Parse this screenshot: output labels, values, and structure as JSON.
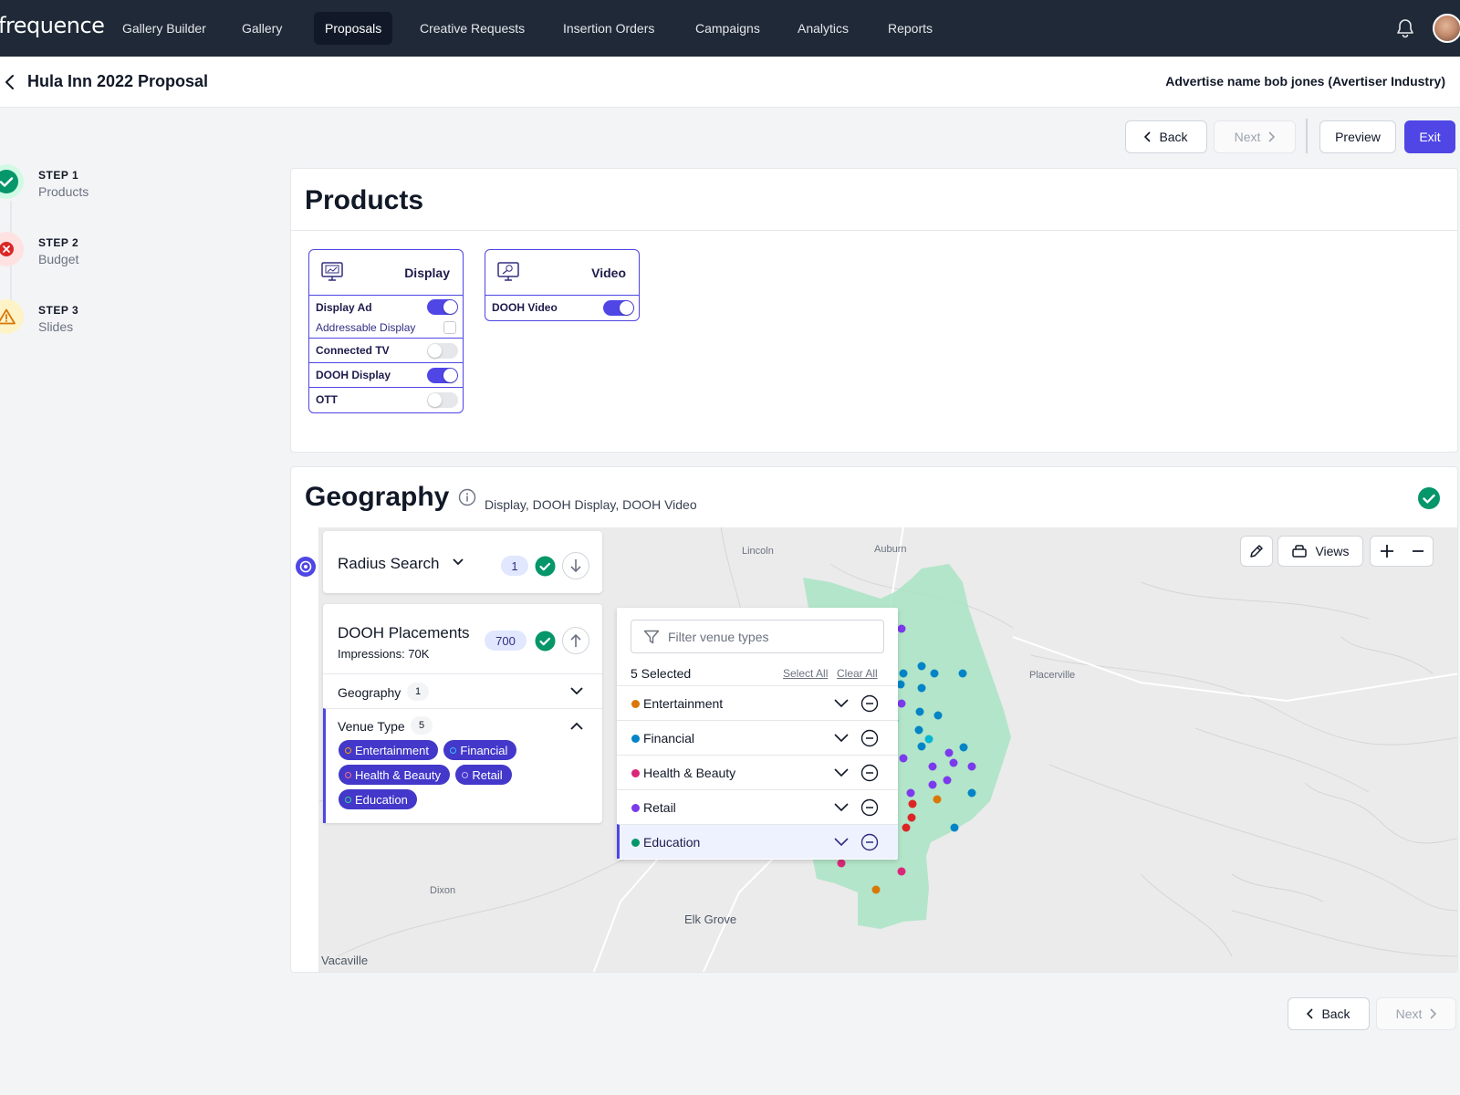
{
  "brand": {
    "logo": "frequence",
    "accent": "#4f46e5",
    "success": "#059669"
  },
  "nav": {
    "items": [
      {
        "label": "Gallery Builder"
      },
      {
        "label": "Gallery"
      },
      {
        "label": "Proposals",
        "active": true
      },
      {
        "label": "Creative Requests"
      },
      {
        "label": "Insertion Orders"
      },
      {
        "label": "Campaigns"
      },
      {
        "label": "Analytics"
      },
      {
        "label": "Reports"
      }
    ],
    "icons": [
      "bell-icon",
      "avatar"
    ]
  },
  "header": {
    "title": "Hula Inn 2022 Proposal",
    "advertiser": "Advertise name bob jones (Avertiser Industry)"
  },
  "actions": {
    "back": "Back",
    "next": "Next",
    "preview": "Preview",
    "exit": "Exit"
  },
  "steps": [
    {
      "label": "STEP 1",
      "name": "Products",
      "status": "complete"
    },
    {
      "label": "STEP 2",
      "name": "Budget",
      "status": "error"
    },
    {
      "label": "STEP 3",
      "name": "Slides",
      "status": "warning"
    }
  ],
  "products": {
    "title": "Products",
    "display": {
      "title": "Display",
      "rows": [
        {
          "label": "Display Ad",
          "on": true
        },
        {
          "label": "Addressable Display",
          "checkbox": false
        },
        {
          "label": "Connected TV",
          "on": false
        },
        {
          "label": "DOOH Display",
          "on": true
        },
        {
          "label": "OTT",
          "on": false
        }
      ]
    },
    "video": {
      "title": "Video",
      "rows": [
        {
          "label": "DOOH Video",
          "on": true
        }
      ]
    }
  },
  "geography": {
    "title": "Geography",
    "subtitle": "Display, DOOH Display, DOOH Video",
    "radius_search": {
      "label": "Radius Search",
      "count": "1"
    },
    "dooh": {
      "title": "DOOH Placements",
      "impressions": "Impressions: 70K",
      "count": "700",
      "geography_label": "Geography",
      "geography_count": "1",
      "venue_label": "Venue Type",
      "venue_count": "5",
      "chips": [
        "Entertainment",
        "Financial",
        "Health & Beauty",
        "Retail",
        "Education"
      ]
    },
    "filter": {
      "placeholder": "Filter venue types",
      "selected": "5 Selected",
      "select_all": "Select All",
      "clear_all": "Clear All",
      "venues": [
        {
          "label": "Entertainment",
          "color": "#f59e0b"
        },
        {
          "label": "Financial",
          "color": "#0ea5e9"
        },
        {
          "label": "Health & Beauty",
          "color": "#e11d48"
        },
        {
          "label": "Retail",
          "color": "#8b5cf6"
        },
        {
          "label": "Education",
          "color": "#10b981"
        }
      ]
    },
    "map": {
      "views_label": "Views",
      "places": [
        "Lincoln",
        "Auburn",
        "Placerville",
        "Dixon",
        "Elk Grove",
        "Vacaville"
      ]
    }
  },
  "footer": {
    "back": "Back",
    "next": "Next"
  }
}
